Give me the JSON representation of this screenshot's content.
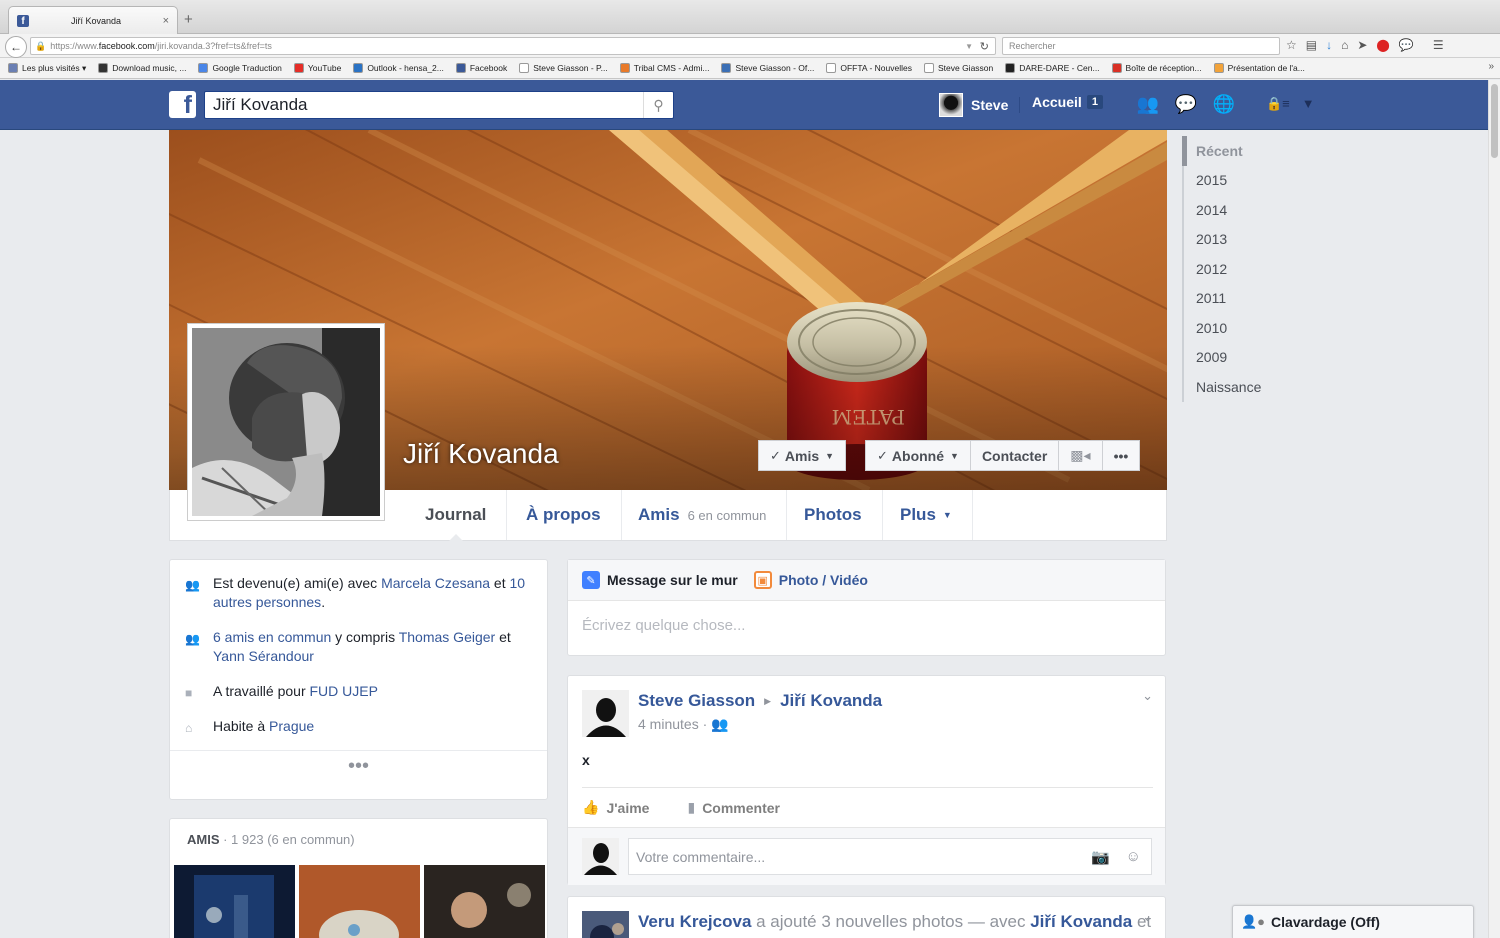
{
  "browser": {
    "tab_title": "Jiří Kovanda",
    "tab_close": "×",
    "new_tab": "+",
    "url_prefix": "https://www.",
    "url_domain": "facebook.com",
    "url_path": "/jiri.kovanda.3?fref=ts&fref=ts",
    "search_placeholder": "Rechercher",
    "bookmarks": [
      {
        "label": "Les plus visités ▾",
        "color": "#6a7fb3"
      },
      {
        "label": "Download music, ...",
        "color": "#333333"
      },
      {
        "label": "Google Traduction",
        "color": "#4a86e8"
      },
      {
        "label": "YouTube",
        "color": "#e52d27"
      },
      {
        "label": "Outlook - hensa_2...",
        "color": "#2a72c4"
      },
      {
        "label": "Facebook",
        "color": "#3b5998"
      },
      {
        "label": "Steve Giasson - P...",
        "color": "#ffffff"
      },
      {
        "label": "Tribal CMS - Admi...",
        "color": "#e87a2a"
      },
      {
        "label": "Steve Giasson - Of...",
        "color": "#3b6fb5"
      },
      {
        "label": "OFFTA - Nouvelles",
        "color": "#ffffff"
      },
      {
        "label": "Steve Giasson",
        "color": "#ffffff"
      },
      {
        "label": "DARE-DARE - Cen...",
        "color": "#222222"
      },
      {
        "label": "Boîte de réception...",
        "color": "#d93025"
      },
      {
        "label": "Présentation de l'a...",
        "color": "#f2a33a"
      }
    ],
    "bookmarks_more": "»"
  },
  "fb": {
    "search_value": "Jiří Kovanda",
    "user_name": "Steve",
    "home_label": "Accueil",
    "home_count": "1"
  },
  "timeline_nav": [
    "Récent",
    "2015",
    "2014",
    "2013",
    "2012",
    "2011",
    "2010",
    "2009",
    "Naissance"
  ],
  "profile": {
    "name": "Jiří Kovanda",
    "actions": {
      "friends": "Amis",
      "following": "Abonné",
      "message": "Contacter",
      "more": "•••"
    },
    "tabs": {
      "timeline": "Journal",
      "about": "À propos",
      "friends": "Amis",
      "friends_sub": "6 en commun",
      "photos": "Photos",
      "more": "Plus"
    }
  },
  "intro": {
    "row1": {
      "pre": "Est devenu(e) ami(e) avec ",
      "link1": "Marcela Czesana",
      "mid": " et ",
      "link2": "10 autres personnes",
      "post": "."
    },
    "row2": {
      "link1": "6 amis en commun",
      "mid": " y compris ",
      "link2": "Thomas Geiger",
      "mid2": " et ",
      "link3": "Yann Sérandour"
    },
    "row3": {
      "pre": "A travaillé pour ",
      "link": "FUD UJEP"
    },
    "row4": {
      "pre": "Habite à ",
      "link": "Prague"
    },
    "more": "•••"
  },
  "friends_box": {
    "title": "AMIS",
    "count": " · 1 923 (6 en commun)"
  },
  "composer": {
    "status_label": "Message sur le mur",
    "photo_label": "Photo / Vidéo",
    "placeholder": "Écrivez quelque chose..."
  },
  "post": {
    "author": "Steve Giasson",
    "target": "Jiří Kovanda",
    "time": "4 minutes · ",
    "body": "x",
    "like": "J'aime",
    "comment": "Commenter",
    "comment_placeholder": "Votre commentaire..."
  },
  "post2": {
    "author": "Veru Krejcova",
    "action": " a ajouté 3 nouvelles photos — avec ",
    "tagged": "Jiří Kovanda",
    "tail": " et"
  },
  "chat": {
    "label": "Clavardage (Off)"
  },
  "colors": {
    "fb_blue": "#3b5998",
    "link": "#365899"
  }
}
